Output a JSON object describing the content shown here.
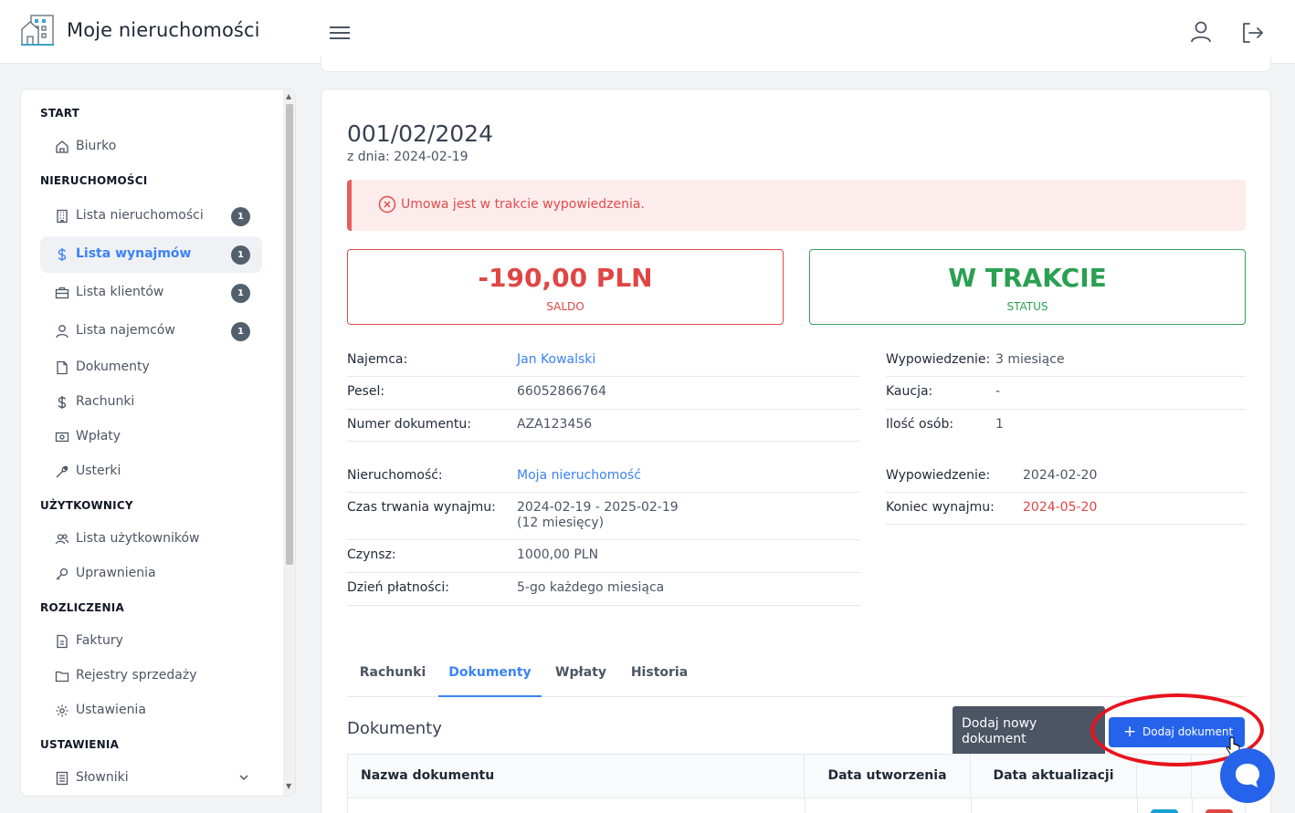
{
  "app": {
    "title": "Moje nieruchomości"
  },
  "sidebar": {
    "sections": {
      "start": "START",
      "nieruchomosci": "NIERUCHOMOŚCI",
      "uzytkownicy": "UŻYTKOWNICY",
      "rozliczenia": "ROZLICZENIA",
      "ustawienia": "USTAWIENIA"
    },
    "items": {
      "biurko": "Biurko",
      "lista_nieruchomosci": "Lista nieruchomości",
      "lista_wynajmow": "Lista wynajmów",
      "lista_klientow": "Lista klientów",
      "lista_najemcow": "Lista najemców",
      "dokumenty": "Dokumenty",
      "rachunki": "Rachunki",
      "wplaty": "Wpłaty",
      "usterki": "Usterki",
      "lista_uzytkownikow": "Lista użytkowników",
      "uprawnienia": "Uprawnienia",
      "faktury": "Faktury",
      "rejestry_sprzedazy": "Rejestry sprzedaży",
      "ustawienia": "Ustawienia",
      "slowniki": "Słowniki"
    },
    "badges": {
      "lista_nieruchomosci": "1",
      "lista_wynajmow": "1",
      "lista_klientow": "1",
      "lista_najemcow": "1"
    }
  },
  "contract": {
    "number": "001/02/2024",
    "date": "z dnia: 2024-02-19",
    "alert": "Umowa jest w trakcie wypowiedzenia.",
    "saldo_value": "-190,00 PLN",
    "saldo_label": "SALDO",
    "status_value": "W TRAKCIE",
    "status_label": "STATUS"
  },
  "details_left": {
    "najemca_label": "Najemca:",
    "najemca_value": "Jan Kowalski",
    "pesel_label": "Pesel:",
    "pesel_value": "66052866764",
    "numer_label": "Numer dokumentu:",
    "numer_value": "AZA123456",
    "nieruchomosc_label": "Nieruchomość:",
    "nieruchomosc_value": "Moja nieruchomość",
    "czas_label": "Czas trwania wynajmu:",
    "czas_value": "2024-02-19 - 2025-02-19",
    "czas_value2": "(12 miesięcy)",
    "czynsz_label": "Czynsz:",
    "czynsz_value": "1000,00 PLN",
    "dzien_label": "Dzień płatności:",
    "dzien_value": "5-go każdego miesiąca"
  },
  "details_right": {
    "wypowiedzenie_label": "Wypowiedzenie:",
    "wypowiedzenie_value": "3 miesiące",
    "kaucja_label": "Kaucja:",
    "kaucja_value": "-",
    "osoby_label": "Ilość osób:",
    "osoby_value": "1",
    "wyp_data_label": "Wypowiedzenie:",
    "wyp_data_value": "2024-02-20",
    "koniec_label": "Koniec wynajmu:",
    "koniec_value": "2024-05-20"
  },
  "tabs": [
    "Rachunki",
    "Dokumenty",
    "Wpłaty",
    "Historia"
  ],
  "documents": {
    "title": "Dokumenty",
    "tooltip": "Dodaj nowy dokument",
    "add_label": "Dodaj dokument",
    "columns": [
      "Nazwa dokumentu",
      "Data utworzenia",
      "Data aktualizacji"
    ]
  },
  "colors": {
    "accent": "#3b82f6",
    "danger": "#e04545",
    "success": "#2aa052",
    "primary_button": "#2563eb"
  }
}
